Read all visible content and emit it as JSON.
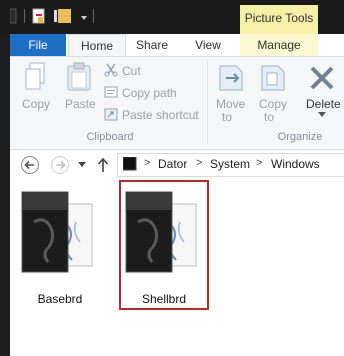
{
  "window": {
    "contextual_tab": "Picture Tools"
  },
  "ribbon": {
    "tabs": [
      "File",
      "Home",
      "Share",
      "View",
      "Manage"
    ],
    "clipboard": {
      "copy": "Copy",
      "paste": "Paste",
      "cut": "Cut",
      "copy_path": "Copy path",
      "paste_shortcut": "Paste shortcut",
      "group": "Clipboard"
    },
    "organize": {
      "move_to_1": "Move",
      "move_to_2": "to",
      "copy_to_1": "Copy",
      "copy_to_2": "to",
      "delete": "Delete",
      "group": "Organize"
    }
  },
  "address": {
    "crumbs": [
      "Dator",
      "System",
      "Windows"
    ]
  },
  "files": [
    {
      "name": "Basebrd"
    },
    {
      "name": "Shellbrd"
    }
  ],
  "colors": {
    "file_tab": "#1f6fc5",
    "picture_tools": "#f5f0a8",
    "selection_border": "#b52c2c"
  }
}
